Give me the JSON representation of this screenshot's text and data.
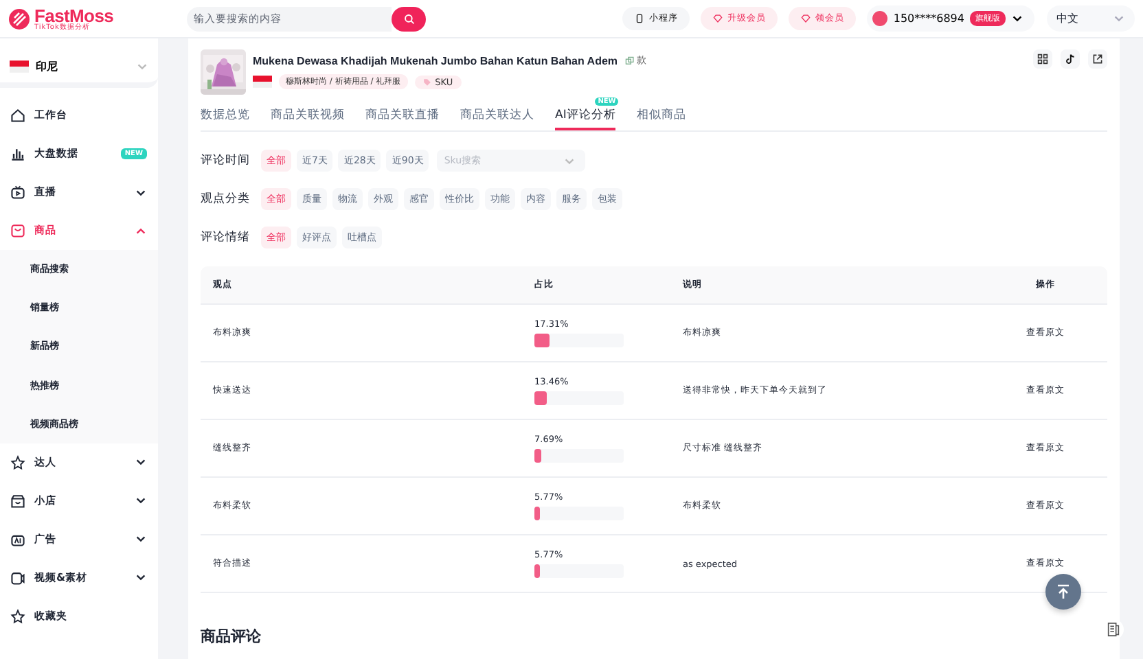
{
  "header": {
    "logo": {
      "name": "FastMoss",
      "tagline": "TikTok数据分析"
    },
    "search": {
      "placeholder": "输入要搜索的内容"
    },
    "actions": [
      {
        "kind": "plain",
        "label": "小程序"
      },
      {
        "kind": "pink",
        "label": "升级会员"
      },
      {
        "kind": "pink",
        "label": "领会员"
      }
    ],
    "user": {
      "phone": "150****6894",
      "badge": "旗舰版"
    },
    "language": "中文"
  },
  "sidebar": {
    "region": "印尼",
    "items": [
      {
        "label": "工作台",
        "selected": false
      },
      {
        "label": "大盘数据",
        "badge": "NEW",
        "selected": false
      },
      {
        "label": "直播",
        "expanded": false,
        "selected": false
      },
      {
        "label": "商品",
        "expanded": true,
        "selected": true,
        "children": [
          {
            "label": "商品搜索"
          },
          {
            "label": "销量榜"
          },
          {
            "label": "新品榜"
          },
          {
            "label": "热推榜"
          },
          {
            "label": "视频商品榜"
          }
        ]
      },
      {
        "label": "达人",
        "expanded": false,
        "selected": false
      },
      {
        "label": "小店",
        "expanded": false,
        "selected": false
      },
      {
        "label": "广告",
        "expanded": false,
        "selected": false
      },
      {
        "label": "视频&素材",
        "expanded": false,
        "selected": false
      },
      {
        "label": "收藏夹",
        "selected": false
      }
    ]
  },
  "product": {
    "title": "Mukena Dewasa Khadijah Mukenah Jumbo Bahan Katun Bahan Adem",
    "variant": "款",
    "category": "穆斯林时尚 / 祈祷用品 / 礼拜服",
    "sku_tag": "SKU"
  },
  "tabs": [
    {
      "label": "数据总览",
      "selected": false
    },
    {
      "label": "商品关联视频",
      "selected": false
    },
    {
      "label": "商品关联直播",
      "selected": false
    },
    {
      "label": "商品关联达人",
      "selected": false
    },
    {
      "label": "AI评论分析",
      "selected": true,
      "badge": "NEW"
    },
    {
      "label": "相似商品",
      "selected": false
    }
  ],
  "filters": [
    {
      "label": "评论时间",
      "options": [
        {
          "label": "全部",
          "selected": true
        },
        {
          "label": "近7天",
          "selected": false
        },
        {
          "label": "近28天",
          "selected": false
        },
        {
          "label": "近90天",
          "selected": false
        }
      ],
      "select": {
        "placeholder": "Sku搜索"
      }
    },
    {
      "label": "观点分类",
      "options": [
        {
          "label": "全部",
          "selected": true
        },
        {
          "label": "质量",
          "selected": false
        },
        {
          "label": "物流",
          "selected": false
        },
        {
          "label": "外观",
          "selected": false
        },
        {
          "label": "感官",
          "selected": false
        },
        {
          "label": "性价比",
          "selected": false
        },
        {
          "label": "功能",
          "selected": false
        },
        {
          "label": "内容",
          "selected": false
        },
        {
          "label": "服务",
          "selected": false
        },
        {
          "label": "包装",
          "selected": false
        }
      ]
    },
    {
      "label": "评论情绪",
      "options": [
        {
          "label": "全部",
          "selected": true
        },
        {
          "label": "好评点",
          "selected": false
        },
        {
          "label": "吐槽点",
          "selected": false
        }
      ]
    }
  ],
  "table": {
    "columns": [
      "观点",
      "占比",
      "说明",
      "操作"
    ],
    "rows": [
      {
        "viewpoint": "布料凉爽",
        "share": "17.31%",
        "level": 0.1731,
        "note": "布料凉爽",
        "action": "查看原文"
      },
      {
        "viewpoint": "快速送达",
        "share": "13.46%",
        "level": 0.1346,
        "note": "送得非常快，昨天下单今天就到了",
        "action": "查看原文"
      },
      {
        "viewpoint": "缝线整齐",
        "share": "7.69%",
        "level": 0.0769,
        "note": "尺寸标准 缝线整齐",
        "action": "查看原文"
      },
      {
        "viewpoint": "布料柔软",
        "share": "5.77%",
        "level": 0.0577,
        "note": "布料柔软",
        "action": "查看原文"
      },
      {
        "viewpoint": "符合描述",
        "share": "5.77%",
        "level": 0.0577,
        "note": "as expected",
        "action": "查看原文"
      }
    ]
  },
  "reviews_heading": "商品评论"
}
